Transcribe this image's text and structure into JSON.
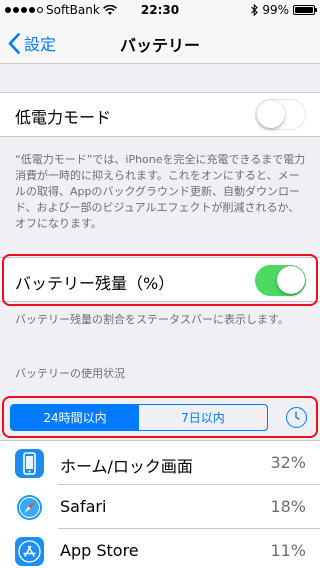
{
  "status_bar": {
    "carrier": "SoftBank",
    "time": "22:30",
    "battery_text": "99%",
    "battery_level": 0.99,
    "signal_bars_filled": 4,
    "signal_bars_total": 5
  },
  "nav": {
    "back_label": "設定",
    "title": "バッテリー"
  },
  "low_power": {
    "label": "低電力モード",
    "enabled": false,
    "note": "“低電力モード”では、iPhoneを完全に充電できるまで電力消費が一時的に抑えられます。これをオンにすると、メールの取得、Appのバックグラウンド更新、自動ダウンロード、およびー部のビジュアルエフェクトが削減されるか、オフになります。"
  },
  "battery_percentage": {
    "label": "バッテリー残量（%）",
    "enabled": true,
    "note": "バッテリー残量の割合をステータスバーに表示します。"
  },
  "usage": {
    "section_header": "バッテリーの使用状況",
    "segments": [
      "24時間以内",
      "7日以内"
    ],
    "selected_segment": 0,
    "apps": [
      {
        "name": "ホーム/ロック画面",
        "percent": "32%",
        "icon": "home-lock-screen-icon"
      },
      {
        "name": "Safari",
        "percent": "18%",
        "icon": "safari-icon"
      },
      {
        "name": "App Store",
        "percent": "11%",
        "icon": "app-store-icon"
      }
    ]
  },
  "colors": {
    "accent": "#007aff",
    "toggle_on": "#4cd964",
    "highlight": "#e8101c",
    "background": "#efeff4"
  }
}
